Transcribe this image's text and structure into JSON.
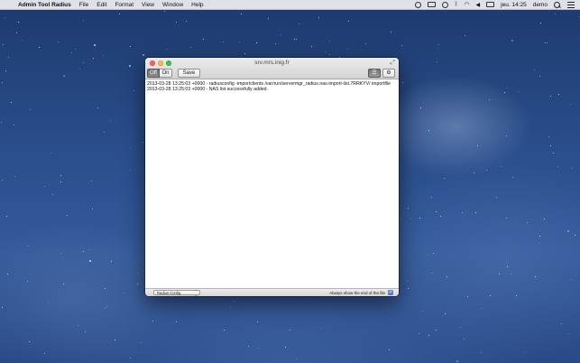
{
  "menubar": {
    "app_name": "Admin Tool Radius",
    "menus": [
      "File",
      "Edit",
      "Format",
      "View",
      "Window",
      "Help"
    ],
    "clock": "jeu. 14:25",
    "user": "demo"
  },
  "window": {
    "title": "srv.mrs.inig.fr",
    "toolbar": {
      "off_label": "Off",
      "on_label": "On",
      "save_label": "Save",
      "active_toggle": "Off"
    },
    "log_lines": [
      "2013-03-28 13:25:03 +0000 - radiusconfig -importclients /var/run/servermgr_radius.nas-import-list.7RRKYV/ importfile",
      "2013-03-28 13:25:03 +0000 - NAS list successfully added."
    ],
    "statusbar": {
      "selected_config": "Radius Config",
      "checkbox_label": "Always show the end of the file",
      "checkbox_checked": true
    }
  },
  "colors": {
    "close": "#fc605b",
    "minimize": "#fdbc40",
    "maximize": "#34c84a",
    "accent": "#3a6fd8"
  }
}
